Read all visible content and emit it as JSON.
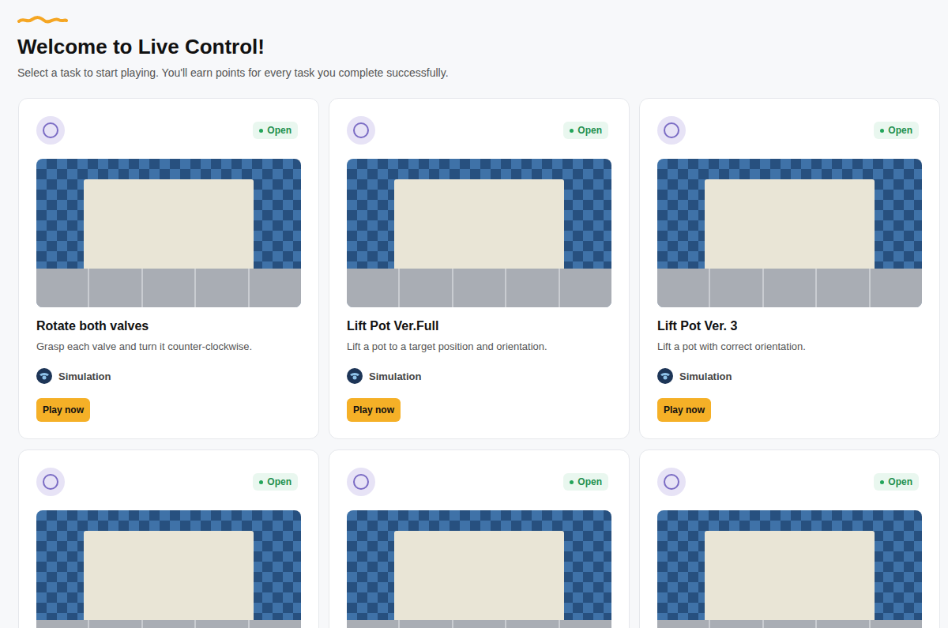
{
  "header": {
    "title": "Welcome to Live Control!",
    "subtitle": "Select a task to start playing. You'll earn points for every task you complete successfully."
  },
  "tasks": [
    {
      "status": "Open",
      "title": "Rotate both valves",
      "description": "Grasp each valve and turn it counter-clockwise.",
      "platform": "Simulation",
      "button": "Play now"
    },
    {
      "status": "Open",
      "title": "Lift Pot Ver.Full",
      "description": "Lift a pot to a target position and orientation.",
      "platform": "Simulation",
      "button": "Play now"
    },
    {
      "status": "Open",
      "title": "Lift Pot Ver. 3",
      "description": "Lift a pot with correct orientation.",
      "platform": "Simulation",
      "button": "Play now"
    },
    {
      "status": "Open"
    },
    {
      "status": "Open"
    },
    {
      "status": "Open"
    }
  ]
}
